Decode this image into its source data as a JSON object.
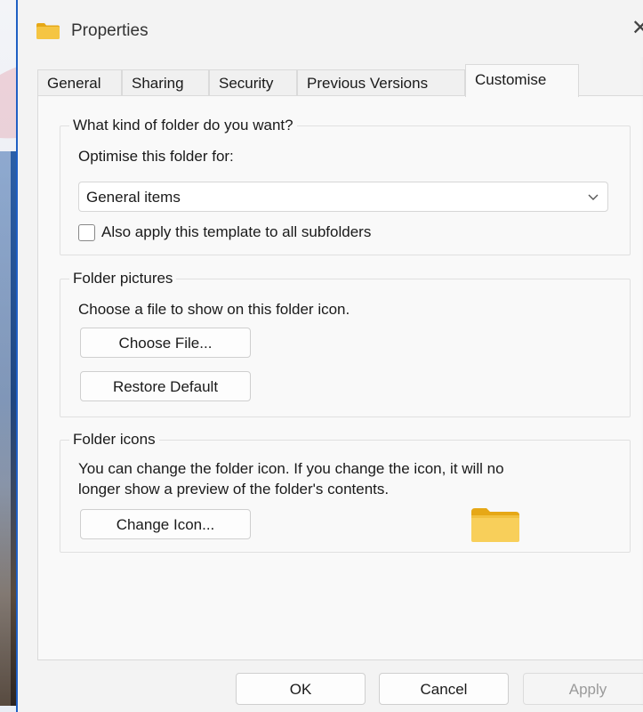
{
  "window": {
    "title": "Properties",
    "close_glyph": "✕"
  },
  "tabs": [
    {
      "label": "General"
    },
    {
      "label": "Sharing"
    },
    {
      "label": "Security"
    },
    {
      "label": "Previous Versions"
    },
    {
      "label": "Customise",
      "active": true
    }
  ],
  "folder_type": {
    "legend": "What kind of folder do you want?",
    "optimise_label": "Optimise this folder for:",
    "selected": "General items",
    "apply_subfolders_label": "Also apply this template to all subfolders",
    "apply_subfolders_checked": false
  },
  "folder_pictures": {
    "legend": "Folder pictures",
    "description": "Choose a file to show on this folder icon.",
    "choose_file_label": "Choose File...",
    "restore_default_label": "Restore Default"
  },
  "folder_icons": {
    "legend": "Folder icons",
    "description_line1": "You can change the folder icon. If you change the icon, it will no",
    "description_line2": "longer show a preview of the folder's contents.",
    "change_icon_label": "Change Icon..."
  },
  "footer": {
    "ok_label": "OK",
    "cancel_label": "Cancel",
    "apply_label": "Apply"
  },
  "icons": {
    "title": "folder-icon",
    "preview": "folder-icon",
    "dropdown": "chevron-down-icon",
    "close": "close-icon"
  },
  "colors": {
    "folder": "#f5c542",
    "accent": "#1f5fc4"
  }
}
